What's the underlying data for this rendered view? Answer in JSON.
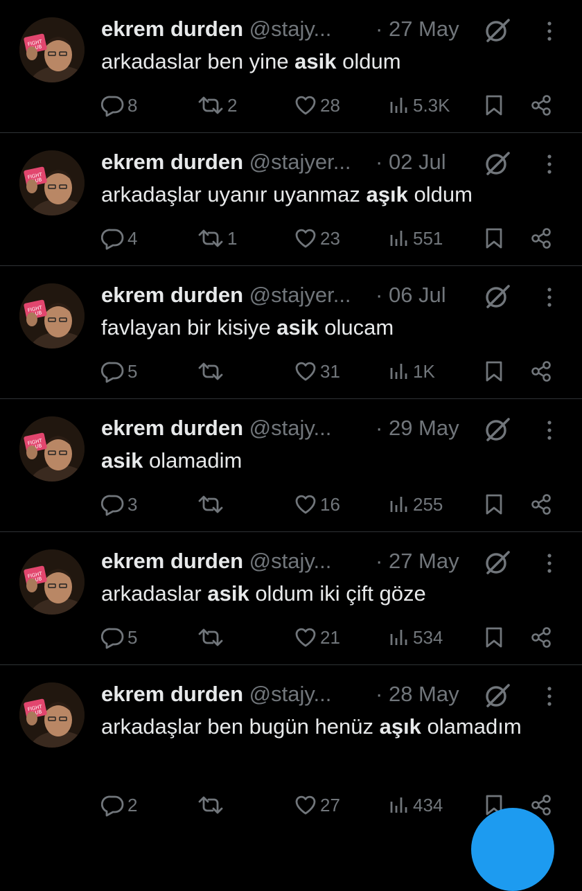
{
  "tweets": [
    {
      "name": "ekrem durden",
      "handle": "@stajy...",
      "sep": "·",
      "date": "27 May",
      "text_before": "arkadaslar ben yine ",
      "text_bold": "asik",
      "text_after": " oldum",
      "replies": "8",
      "retweets": "2",
      "likes": "28",
      "views": "5.3K"
    },
    {
      "name": "ekrem durden",
      "handle": "@stajyer...",
      "sep": "·",
      "date": "02 Jul",
      "text_before": "arkadaşlar uyanır uyanmaz ",
      "text_bold": "aşık",
      "text_after": " oldum",
      "replies": "4",
      "retweets": "1",
      "likes": "23",
      "views": "551"
    },
    {
      "name": "ekrem durden",
      "handle": "@stajyer...",
      "sep": "·",
      "date": "06 Jul",
      "text_before": "favlayan bir kisiye ",
      "text_bold": "asik",
      "text_after": " olucam",
      "replies": "5",
      "retweets": "",
      "likes": "31",
      "views": "1K"
    },
    {
      "name": "ekrem durden",
      "handle": "@stajy...",
      "sep": "·",
      "date": "29 May",
      "text_before": "",
      "text_bold": "asik",
      "text_after": " olamadim",
      "replies": "3",
      "retweets": "",
      "likes": "16",
      "views": "255"
    },
    {
      "name": "ekrem durden",
      "handle": "@stajy...",
      "sep": "·",
      "date": "27 May",
      "text_before": "arkadaslar ",
      "text_bold": "asik",
      "text_after": " oldum iki çift göze",
      "replies": "5",
      "retweets": "",
      "likes": "21",
      "views": "534"
    },
    {
      "name": "ekrem durden",
      "handle": "@stajy...",
      "sep": "·",
      "date": "28 May",
      "text_before": "arkadaşlar ben bugün henüz ",
      "text_bold": "aşık",
      "text_after": " olamadım",
      "replies": "2",
      "retweets": "",
      "likes": "27",
      "views": "434"
    }
  ],
  "icons": {
    "avatar": "avatar-photo",
    "grok": "grok-icon",
    "more": "more-icon",
    "reply": "reply-icon",
    "retweet": "retweet-icon",
    "like": "like-icon",
    "views": "views-icon",
    "bookmark": "bookmark-icon",
    "share": "share-icon"
  },
  "colors": {
    "background": "#000000",
    "text": "#e7e9ea",
    "muted": "#71767b",
    "divider": "#2f3336",
    "accent": "#1d9bf0"
  }
}
